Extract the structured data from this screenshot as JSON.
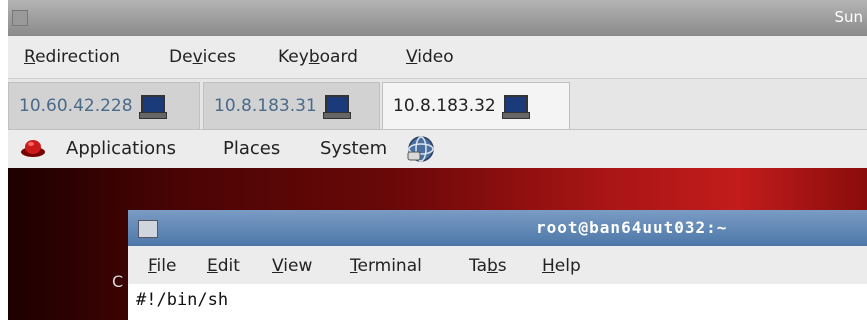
{
  "titlebar": {
    "title": "Sun"
  },
  "menubar": {
    "items": [
      {
        "pre": "",
        "u": "R",
        "post": "edirection"
      },
      {
        "pre": "De",
        "u": "v",
        "post": "ices"
      },
      {
        "pre": "Key",
        "u": "b",
        "post": "oard"
      },
      {
        "pre": "",
        "u": "V",
        "post": "ideo"
      }
    ]
  },
  "tabs": [
    {
      "label": "10.60.42.228",
      "icon": "monitor-icon"
    },
    {
      "label": "10.8.183.31",
      "icon": "monitor-icon"
    },
    {
      "label": "10.8.183.32",
      "icon": "monitor-icon"
    }
  ],
  "panel": {
    "applications": "Applications",
    "places": "Places",
    "system": "System"
  },
  "desktop": {
    "partial_text": "C"
  },
  "terminal": {
    "title": "root@ban64uut032:~",
    "menu": [
      {
        "pre": "",
        "u": "F",
        "post": "ile"
      },
      {
        "pre": "",
        "u": "E",
        "post": "dit"
      },
      {
        "pre": "",
        "u": "V",
        "post": "iew"
      },
      {
        "pre": "",
        "u": "T",
        "post": "erminal"
      },
      {
        "pre": "Ta",
        "u": "b",
        "post": "s"
      },
      {
        "pre": "",
        "u": "H",
        "post": "elp"
      }
    ],
    "line": "#!/bin/sh"
  },
  "colors": {
    "terminal_titlebar": "#4d77a8",
    "desktop_red": "#aa1515"
  }
}
